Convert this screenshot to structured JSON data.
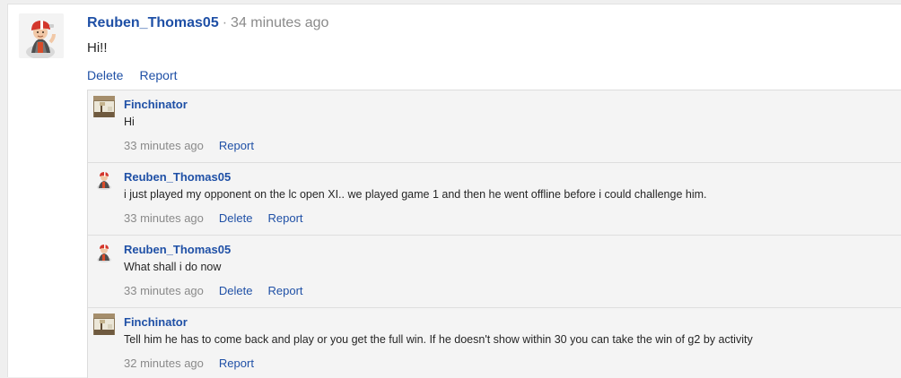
{
  "main_post": {
    "username": "Reuben_Thomas05",
    "separator": "·",
    "time": "34 minutes ago",
    "text": "Hi!!",
    "delete_label": "Delete",
    "report_label": "Report"
  },
  "replies": [
    {
      "username": "Finchinator",
      "text": "Hi",
      "time": "33 minutes ago",
      "delete_label": "",
      "report_label": "Report"
    },
    {
      "username": "Reuben_Thomas05",
      "text": "i just played my opponent on the lc open XI.. we played game 1 and then he went offline before i could challenge him.",
      "time": "33 minutes ago",
      "delete_label": "Delete",
      "report_label": "Report"
    },
    {
      "username": "Reuben_Thomas05",
      "text": "What shall i do now",
      "time": "33 minutes ago",
      "delete_label": "Delete",
      "report_label": "Report"
    },
    {
      "username": "Finchinator",
      "text": "Tell him he has to come back and play or you get the full win. If he doesn't show within 30 you can take the win of g2 by activity",
      "time": "32 minutes ago",
      "delete_label": "",
      "report_label": "Report"
    }
  ],
  "colors": {
    "link": "#1f50a6",
    "muted": "#8a8a8a",
    "text": "#262626",
    "page_bg": "#efefef",
    "reply_bg": "#f4f4f4"
  },
  "icons": {
    "main_avatar": "firefighter-avatar-icon",
    "reuben_avatar": "firefighter-avatar-icon",
    "finchinator_avatar": "room-photo-avatar-icon"
  }
}
